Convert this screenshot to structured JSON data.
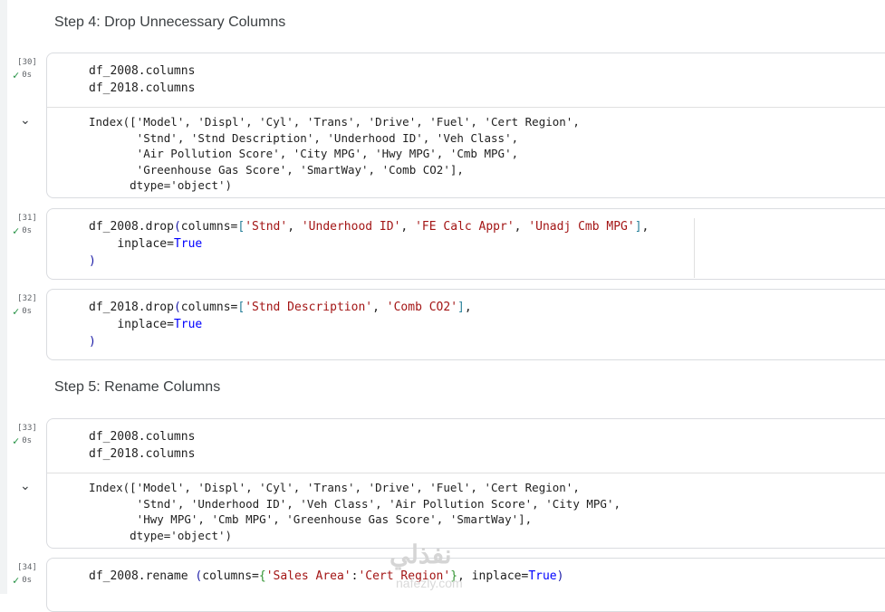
{
  "step4": {
    "title": "Step 4: Drop Unnecessary Columns"
  },
  "step5": {
    "title": "Step 5: Rename Columns"
  },
  "cell30": {
    "exec": "[30]",
    "status": "0s",
    "line1": "df_2008.columns",
    "line2": "df_2018.columns",
    "output": [
      "Index(['Model', 'Displ', 'Cyl', 'Trans', 'Drive', 'Fuel', 'Cert Region',",
      "       'Stnd', 'Stnd Description', 'Underhood ID', 'Veh Class',",
      "       'Air Pollution Score', 'City MPG', 'Hwy MPG', 'Cmb MPG',",
      "       'Greenhouse Gas Score', 'SmartWay', 'Comb CO2'],",
      "      dtype='object')"
    ]
  },
  "cell31": {
    "exec": "[31]",
    "status": "0s",
    "obj": "df_2008",
    "method": ".drop",
    "open": "(",
    "arg": "columns=",
    "lb": "[",
    "s1": "'Stnd'",
    "s2": "'Underhood ID'",
    "s3": "'FE Calc Appr'",
    "s4": "'Unadj Cmb MPG'",
    "sep": ", ",
    "rb": "]",
    "comma": ",",
    "indent": "    ",
    "inplace": "inplace=",
    "true": "True",
    "close": ")"
  },
  "cell32": {
    "exec": "[32]",
    "status": "0s",
    "obj": "df_2018",
    "method": ".drop",
    "open": "(",
    "arg": "columns=",
    "lb": "[",
    "s1": "'Stnd Description'",
    "s2": "'Comb CO2'",
    "sep": ", ",
    "rb": "]",
    "comma": ",",
    "indent": "    ",
    "inplace": "inplace=",
    "true": "True",
    "close": ")"
  },
  "cell33": {
    "exec": "[33]",
    "status": "0s",
    "line1": "df_2008.columns",
    "line2": "df_2018.columns",
    "output": [
      "Index(['Model', 'Displ', 'Cyl', 'Trans', 'Drive', 'Fuel', 'Cert Region',",
      "       'Stnd', 'Underhood ID', 'Veh Class', 'Air Pollution Score', 'City MPG',",
      "       'Hwy MPG', 'Cmb MPG', 'Greenhouse Gas Score', 'SmartWay'],",
      "      dtype='object')"
    ]
  },
  "cell34": {
    "exec": "[34]",
    "status": "0s",
    "obj": "df_2008",
    "method": ".rename ",
    "open": "(",
    "arg": "columns=",
    "lb": "{",
    "k": "'Sales Area'",
    "colon": ":",
    "v": "'Cert Region'",
    "rb": "}",
    "rest": ", inplace=",
    "true": "True",
    "close": ")"
  },
  "watermark": {
    "main": "نفذلي",
    "sub": "nafezly.com"
  }
}
